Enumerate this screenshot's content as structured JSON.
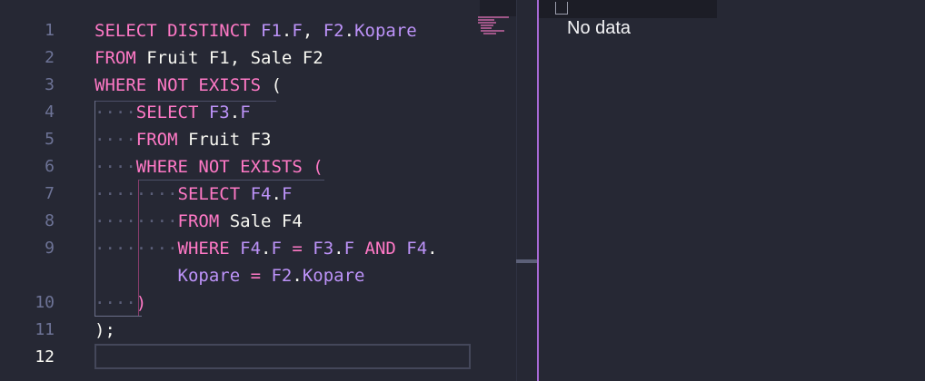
{
  "editor": {
    "line_numbers": [
      "1",
      "2",
      "3",
      "4",
      "5",
      "6",
      "7",
      "8",
      "9",
      "",
      "10",
      "11",
      "12"
    ],
    "active_line": "12",
    "lines": [
      [
        {
          "t": "SELECT DISTINCT ",
          "c": "kw"
        },
        {
          "t": "F1",
          "c": "pu"
        },
        {
          "t": ".",
          "c": "tx"
        },
        {
          "t": "F",
          "c": "pu"
        },
        {
          "t": ", ",
          "c": "tx"
        },
        {
          "t": "F2",
          "c": "pu"
        },
        {
          "t": ".",
          "c": "tx"
        },
        {
          "t": "Kopare",
          "c": "pu"
        }
      ],
      [
        {
          "t": "FROM ",
          "c": "kw"
        },
        {
          "t": "Fruit F1, Sale F2",
          "c": "tx"
        }
      ],
      [
        {
          "t": "WHERE NOT EXISTS ",
          "c": "kw"
        },
        {
          "t": "(",
          "c": "tx"
        }
      ],
      [
        {
          "t": "    ",
          "c": "dot"
        },
        {
          "t": "SELECT ",
          "c": "kw"
        },
        {
          "t": "F3",
          "c": "pu"
        },
        {
          "t": ".",
          "c": "tx"
        },
        {
          "t": "F",
          "c": "pu"
        }
      ],
      [
        {
          "t": "    ",
          "c": "dot"
        },
        {
          "t": "FROM ",
          "c": "kw"
        },
        {
          "t": "Fruit F3",
          "c": "tx"
        }
      ],
      [
        {
          "t": "    ",
          "c": "dot"
        },
        {
          "t": "WHERE NOT EXISTS ",
          "c": "kw"
        },
        {
          "t": "(",
          "c": "kw"
        }
      ],
      [
        {
          "t": "        ",
          "c": "dot"
        },
        {
          "t": "SELECT ",
          "c": "kw"
        },
        {
          "t": "F4",
          "c": "pu"
        },
        {
          "t": ".",
          "c": "tx"
        },
        {
          "t": "F",
          "c": "pu"
        }
      ],
      [
        {
          "t": "        ",
          "c": "dot"
        },
        {
          "t": "FROM ",
          "c": "kw"
        },
        {
          "t": "Sale F4",
          "c": "tx"
        }
      ],
      [
        {
          "t": "        ",
          "c": "dot"
        },
        {
          "t": "WHERE ",
          "c": "kw"
        },
        {
          "t": "F4",
          "c": "pu"
        },
        {
          "t": ".",
          "c": "tx"
        },
        {
          "t": "F",
          "c": "pu"
        },
        {
          "t": " = ",
          "c": "kw"
        },
        {
          "t": "F3",
          "c": "pu"
        },
        {
          "t": ".",
          "c": "tx"
        },
        {
          "t": "F",
          "c": "pu"
        },
        {
          "t": " AND ",
          "c": "kw"
        },
        {
          "t": "F4",
          "c": "pu"
        },
        {
          "t": ".",
          "c": "tx"
        }
      ],
      [
        {
          "t": "        ",
          "c": "tx"
        },
        {
          "t": "Kopare",
          "c": "pu"
        },
        {
          "t": " = ",
          "c": "kw"
        },
        {
          "t": "F2",
          "c": "pu"
        },
        {
          "t": ".",
          "c": "tx"
        },
        {
          "t": "Kopare",
          "c": "pu"
        }
      ],
      [
        {
          "t": "    ",
          "c": "dot"
        },
        {
          "t": ")",
          "c": "kw"
        }
      ],
      [
        {
          "t": ");",
          "c": "tx"
        }
      ],
      [
        {
          "t": "",
          "c": "tx"
        }
      ]
    ]
  },
  "results": {
    "empty_message": "No data"
  },
  "colors": {
    "keyword": "#ff79c6",
    "identifier": "#bd93f9",
    "text": "#f8f8f2",
    "background": "#262834",
    "divider": "#a86ad6"
  }
}
